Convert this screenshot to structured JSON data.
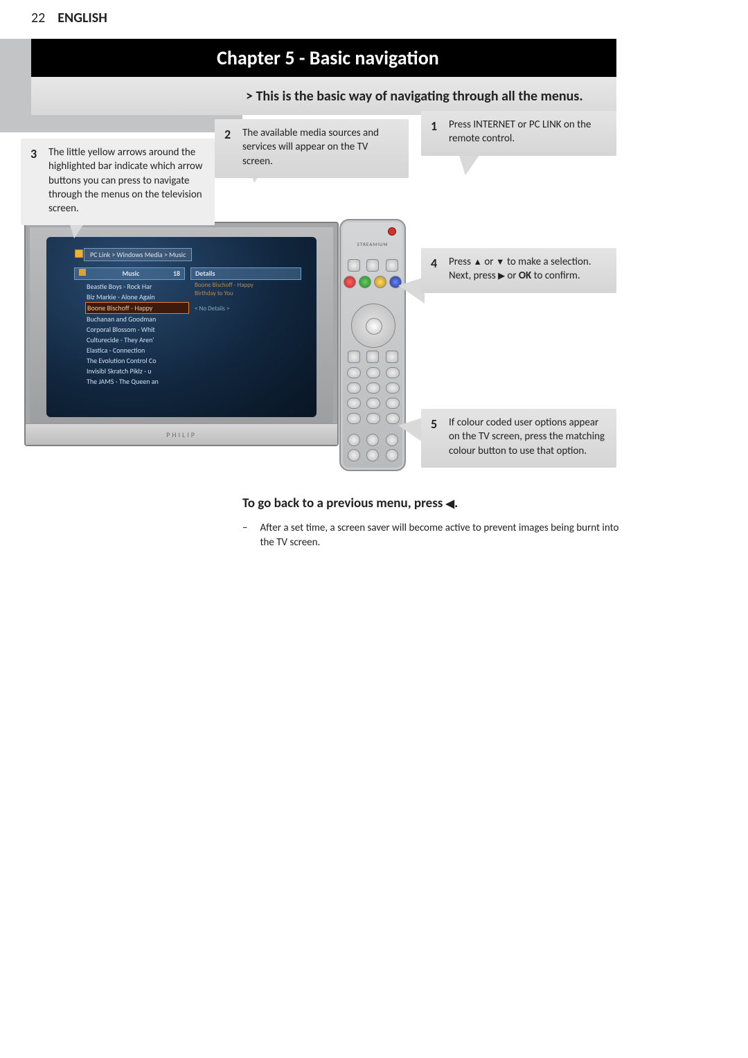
{
  "header": {
    "page_number": "22",
    "language": "ENGLISH"
  },
  "chapter": {
    "title": "Chapter 5 - Basic navigation",
    "subtitle": "> This is the basic way of navigating through all the menus."
  },
  "callouts": {
    "c1": {
      "num": "1",
      "text": "Press INTERNET or PC LINK on the remote control."
    },
    "c2": {
      "num": "2",
      "text": "The available media sources and services will appear on the TV screen."
    },
    "c3": {
      "num": "3",
      "text": "The little yellow arrows around the highlighted bar indicate which arrow buttons you can press to navigate through the menus on the television screen."
    },
    "c4": {
      "num": "4",
      "line1_a": "Press ",
      "line1_b": " or ",
      "line1_c": " to make a selection.",
      "line2_a": "Next, press ",
      "line2_b": " or ",
      "ok": "OK",
      "line2_c": " to confirm."
    },
    "c5": {
      "num": "5",
      "text": "If colour coded user options appear on the TV screen, press the matching colour button to use that option."
    }
  },
  "tv": {
    "breadcrumb": "PC Link > Windows Media > Music",
    "col_left_label": "Music",
    "col_left_count": "18",
    "col_right_label": "Details",
    "list": [
      "Beastie Boys - Rock Har",
      "Biz Markie - Alone Again",
      "Boone Bischoff - Happy",
      "Buchanan and Goodman",
      "Corporal Blossom - Whit",
      "Culturecide - They Aren'",
      "Elastica - Connection",
      "The Evolution Control Co",
      "Invisibl Skratch Piklz - u",
      "The JAMS - The Queen an"
    ],
    "selected_index": 2,
    "detail_title": "Boone Bischoff - Happy",
    "detail_sub": "Birthday to You",
    "no_details": "< No Details >",
    "brand": "PHILIP"
  },
  "back": {
    "heading_a": "To go back to a previous menu, press ",
    "heading_b": ".",
    "note": "After a set time, a screen saver will become active to prevent images being burnt into the TV screen."
  },
  "glyphs": {
    "up": "▲",
    "down": "▼",
    "right": "▶",
    "left": "◀",
    "dash": "–"
  }
}
